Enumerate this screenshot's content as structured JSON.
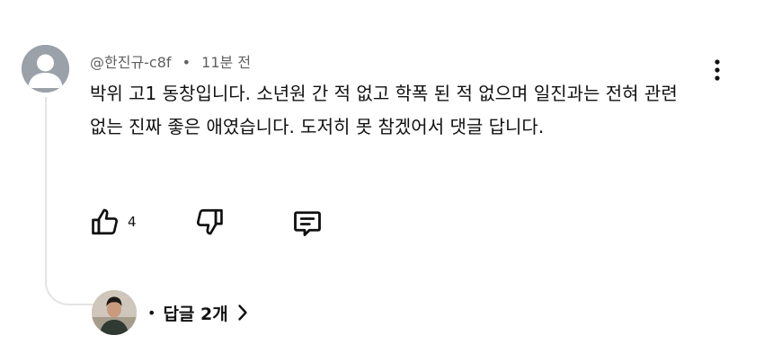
{
  "comment": {
    "author": "@한진규-c8f",
    "separator": "•",
    "time": "11분 전",
    "text": "박위 고1 동창입니다. 소년원 간 적 없고 학폭 된 적 없으며 일진과는 전혀 관련 없는 진짜 좋은 애였습니다. 도저히 못 참겠어서 댓글 답니다.",
    "like_count": "4"
  },
  "replies": {
    "separator": "•",
    "label": "답글 2개"
  },
  "icons": {
    "avatar": "default-avatar-icon",
    "menu": "more-vertical-icon",
    "like": "thumbs-up-icon",
    "dislike": "thumbs-down-icon",
    "reply": "comment-icon",
    "replies_chevron": "chevron-right-icon"
  }
}
